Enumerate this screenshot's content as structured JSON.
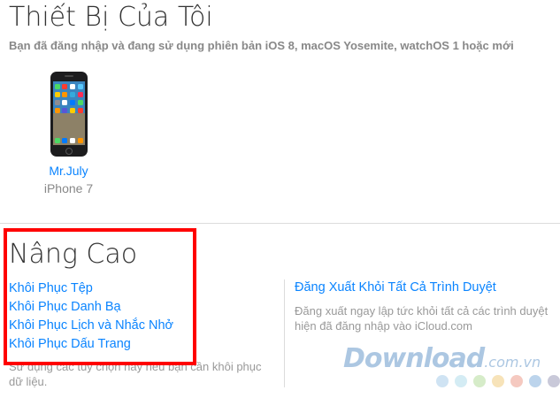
{
  "devices_section": {
    "title": "Thiết Bị Của Tôi",
    "subtitle": "Bạn đã đăng nhập và đang sử dụng phiên bản iOS 8, macOS Yosemite, watchOS 1 hoặc mới",
    "device": {
      "name": "Mr.July",
      "model": "iPhone 7"
    }
  },
  "advanced": {
    "title": "Nâng Cao",
    "links": [
      "Khôi Phục Tệp",
      "Khôi Phục Danh Bạ",
      "Khôi Phục Lịch và Nhắc Nhở",
      "Khôi Phục Dấu Trang"
    ],
    "note": "Sử dụng các tùy chọn này nếu bạn cần khôi phục dữ liệu.",
    "highlight_color": "#ff0000"
  },
  "signout": {
    "link": "Đăng Xuất Khỏi Tất Cả Trình Duyệt",
    "desc_line1": "Đăng xuất ngay lập tức khỏi tất cả các trình duyệt",
    "desc_line2": "hiện đã đăng nhập vào iCloud.com"
  },
  "watermark": {
    "brand": "Download",
    "suffix": ".com.vn",
    "dot_colors": [
      "#cfe3f3",
      "#d4ecf4",
      "#d6ecc9",
      "#f7e3b9",
      "#f5c9c0",
      "#bcd4ec",
      "#c9c9d9"
    ]
  },
  "colors": {
    "link": "#0a84ff",
    "text": "#333333",
    "muted": "#888888"
  }
}
